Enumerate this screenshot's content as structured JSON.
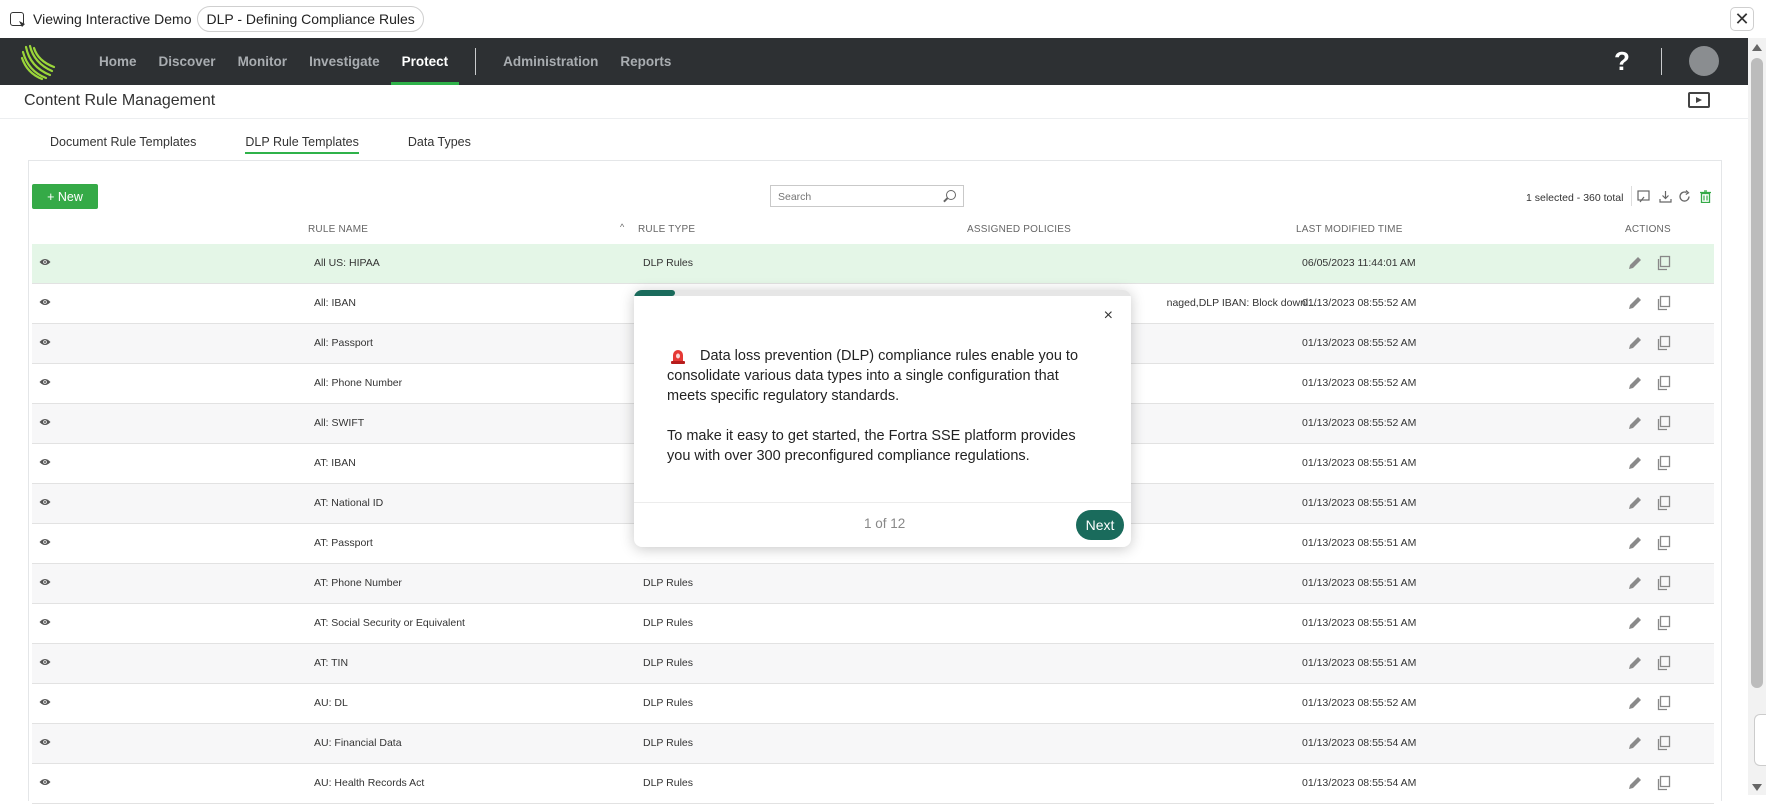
{
  "demo_bar": {
    "label": "Viewing Interactive Demo",
    "pill": "DLP - Defining Compliance Rules",
    "close": "✕"
  },
  "nav": {
    "items": [
      "Home",
      "Discover",
      "Monitor",
      "Investigate",
      "Protect"
    ],
    "items2": [
      "Administration",
      "Reports"
    ],
    "active": "Protect",
    "help": "?"
  },
  "page": {
    "title": "Content Rule Management"
  },
  "tabs": [
    "Document Rule Templates",
    "DLP Rule Templates",
    "Data Types"
  ],
  "active_tab": "DLP Rule Templates",
  "toolbar": {
    "new_label": "+ New",
    "search_placeholder": "Search",
    "selection": "1 selected -  360 total"
  },
  "table": {
    "headers": {
      "rule_name": "RULE NAME",
      "rule_type": "RULE TYPE",
      "assigned": "ASSIGNED POLICIES",
      "modified": "LAST MODIFIED TIME",
      "actions": "ACTIONS"
    },
    "rows": [
      {
        "name": "All US: HIPAA",
        "type": "DLP Rules",
        "policies": "",
        "time": "06/05/2023 11:44:01 AM",
        "selected": true
      },
      {
        "name": "All: IBAN",
        "type": "",
        "policies": "naged,DLP IBAN: Block downl...",
        "time": "01/13/2023 08:55:52 AM"
      },
      {
        "name": "All: Passport",
        "type": "",
        "policies": "",
        "time": "01/13/2023 08:55:52 AM"
      },
      {
        "name": "All: Phone Number",
        "type": "",
        "policies": "",
        "time": "01/13/2023 08:55:52 AM"
      },
      {
        "name": "All: SWIFT",
        "type": "",
        "policies": "",
        "time": "01/13/2023 08:55:52 AM"
      },
      {
        "name": "AT: IBAN",
        "type": "",
        "policies": "",
        "time": "01/13/2023 08:55:51 AM"
      },
      {
        "name": "AT: National ID",
        "type": "",
        "policies": "",
        "time": "01/13/2023 08:55:51 AM"
      },
      {
        "name": "AT: Passport",
        "type": "",
        "policies": "",
        "time": "01/13/2023 08:55:51 AM"
      },
      {
        "name": "AT: Phone Number",
        "type": "DLP Rules",
        "policies": "",
        "time": "01/13/2023 08:55:51 AM"
      },
      {
        "name": "AT: Social Security or Equivalent",
        "type": "DLP Rules",
        "policies": "",
        "time": "01/13/2023 08:55:51 AM"
      },
      {
        "name": "AT: TIN",
        "type": "DLP Rules",
        "policies": "",
        "time": "01/13/2023 08:55:51 AM"
      },
      {
        "name": "AU: DL",
        "type": "DLP Rules",
        "policies": "",
        "time": "01/13/2023 08:55:52 AM"
      },
      {
        "name": "AU: Financial Data",
        "type": "DLP Rules",
        "policies": "",
        "time": "01/13/2023 08:55:54 AM"
      },
      {
        "name": "AU: Health Records Act",
        "type": "DLP Rules",
        "policies": "",
        "time": "01/13/2023 08:55:54 AM"
      }
    ]
  },
  "tour": {
    "paragraph1": "Data loss prevention (DLP) compliance rules enable you to consolidate various data types into a single configuration that meets specific regulatory standards.",
    "paragraph2": "To make it easy to get started, the Fortra SSE platform provides you with over 300 preconfigured compliance regulations.",
    "page": "1 of 12",
    "next_label": "Next",
    "close": "×",
    "progress": 0.083
  },
  "colors": {
    "accent_green": "#35aa47",
    "nav_bg": "#2d3033",
    "tour_teal": "#1a6b5c",
    "selected_row": "#e4f6e7"
  }
}
